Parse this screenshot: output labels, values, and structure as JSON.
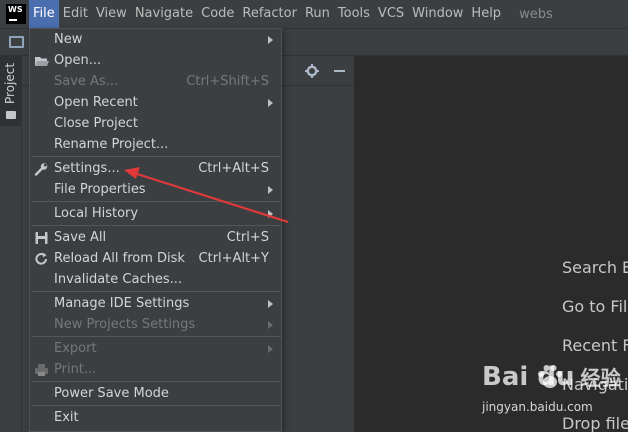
{
  "menubar": {
    "logo": "WS",
    "items": [
      "File",
      "Edit",
      "View",
      "Navigate",
      "Code",
      "Refactor",
      "Run",
      "Tools",
      "VCS",
      "Window",
      "Help"
    ],
    "title": "webs"
  },
  "side_panel": {
    "tab_label": "Project"
  },
  "file_menu": {
    "items": [
      {
        "label": "New",
        "shortcut": "",
        "submenu": true,
        "disabled": false
      },
      {
        "label": "Open...",
        "shortcut": "",
        "submenu": false,
        "disabled": false,
        "icon": "folder-open-icon"
      },
      {
        "label": "Save As...",
        "shortcut": "Ctrl+Shift+S",
        "submenu": false,
        "disabled": true
      },
      {
        "label": "Open Recent",
        "shortcut": "",
        "submenu": true,
        "disabled": false
      },
      {
        "label": "Close Project",
        "shortcut": "",
        "submenu": false,
        "disabled": false
      },
      {
        "label": "Rename Project...",
        "shortcut": "",
        "submenu": false,
        "disabled": false
      },
      {
        "label": "Settings...",
        "shortcut": "Ctrl+Alt+S",
        "submenu": false,
        "disabled": false,
        "icon": "wrench-icon"
      },
      {
        "label": "File Properties",
        "shortcut": "",
        "submenu": true,
        "disabled": false
      },
      {
        "label": "Local History",
        "shortcut": "",
        "submenu": true,
        "disabled": false
      },
      {
        "label": "Save All",
        "shortcut": "Ctrl+S",
        "submenu": false,
        "disabled": false,
        "icon": "save-icon"
      },
      {
        "label": "Reload All from Disk",
        "shortcut": "Ctrl+Alt+Y",
        "submenu": false,
        "disabled": false,
        "icon": "reload-icon"
      },
      {
        "label": "Invalidate Caches...",
        "shortcut": "",
        "submenu": false,
        "disabled": false
      },
      {
        "label": "Manage IDE Settings",
        "shortcut": "",
        "submenu": true,
        "disabled": false
      },
      {
        "label": "New Projects Settings",
        "shortcut": "",
        "submenu": true,
        "disabled": true
      },
      {
        "label": "Export",
        "shortcut": "",
        "submenu": true,
        "disabled": true
      },
      {
        "label": "Print...",
        "shortcut": "",
        "submenu": false,
        "disabled": true,
        "icon": "print-icon"
      },
      {
        "label": "Power Save Mode",
        "shortcut": "",
        "submenu": false,
        "disabled": false
      },
      {
        "label": "Exit",
        "shortcut": "",
        "submenu": false,
        "disabled": false
      }
    ]
  },
  "welcome": {
    "lines": [
      "Search E",
      "Go to Fil",
      "Recent F",
      "Navigatio",
      "Drop file"
    ]
  },
  "watermark": {
    "brand": "Bai du",
    "brand_cn": "经验",
    "url": "jingyan.baidu.com"
  },
  "colors": {
    "menubar_bg": "#3c3f41",
    "active_menu": "#4b6eaf",
    "editor_bg": "#2b2b2b",
    "annotation_arrow": "#e0393a"
  }
}
